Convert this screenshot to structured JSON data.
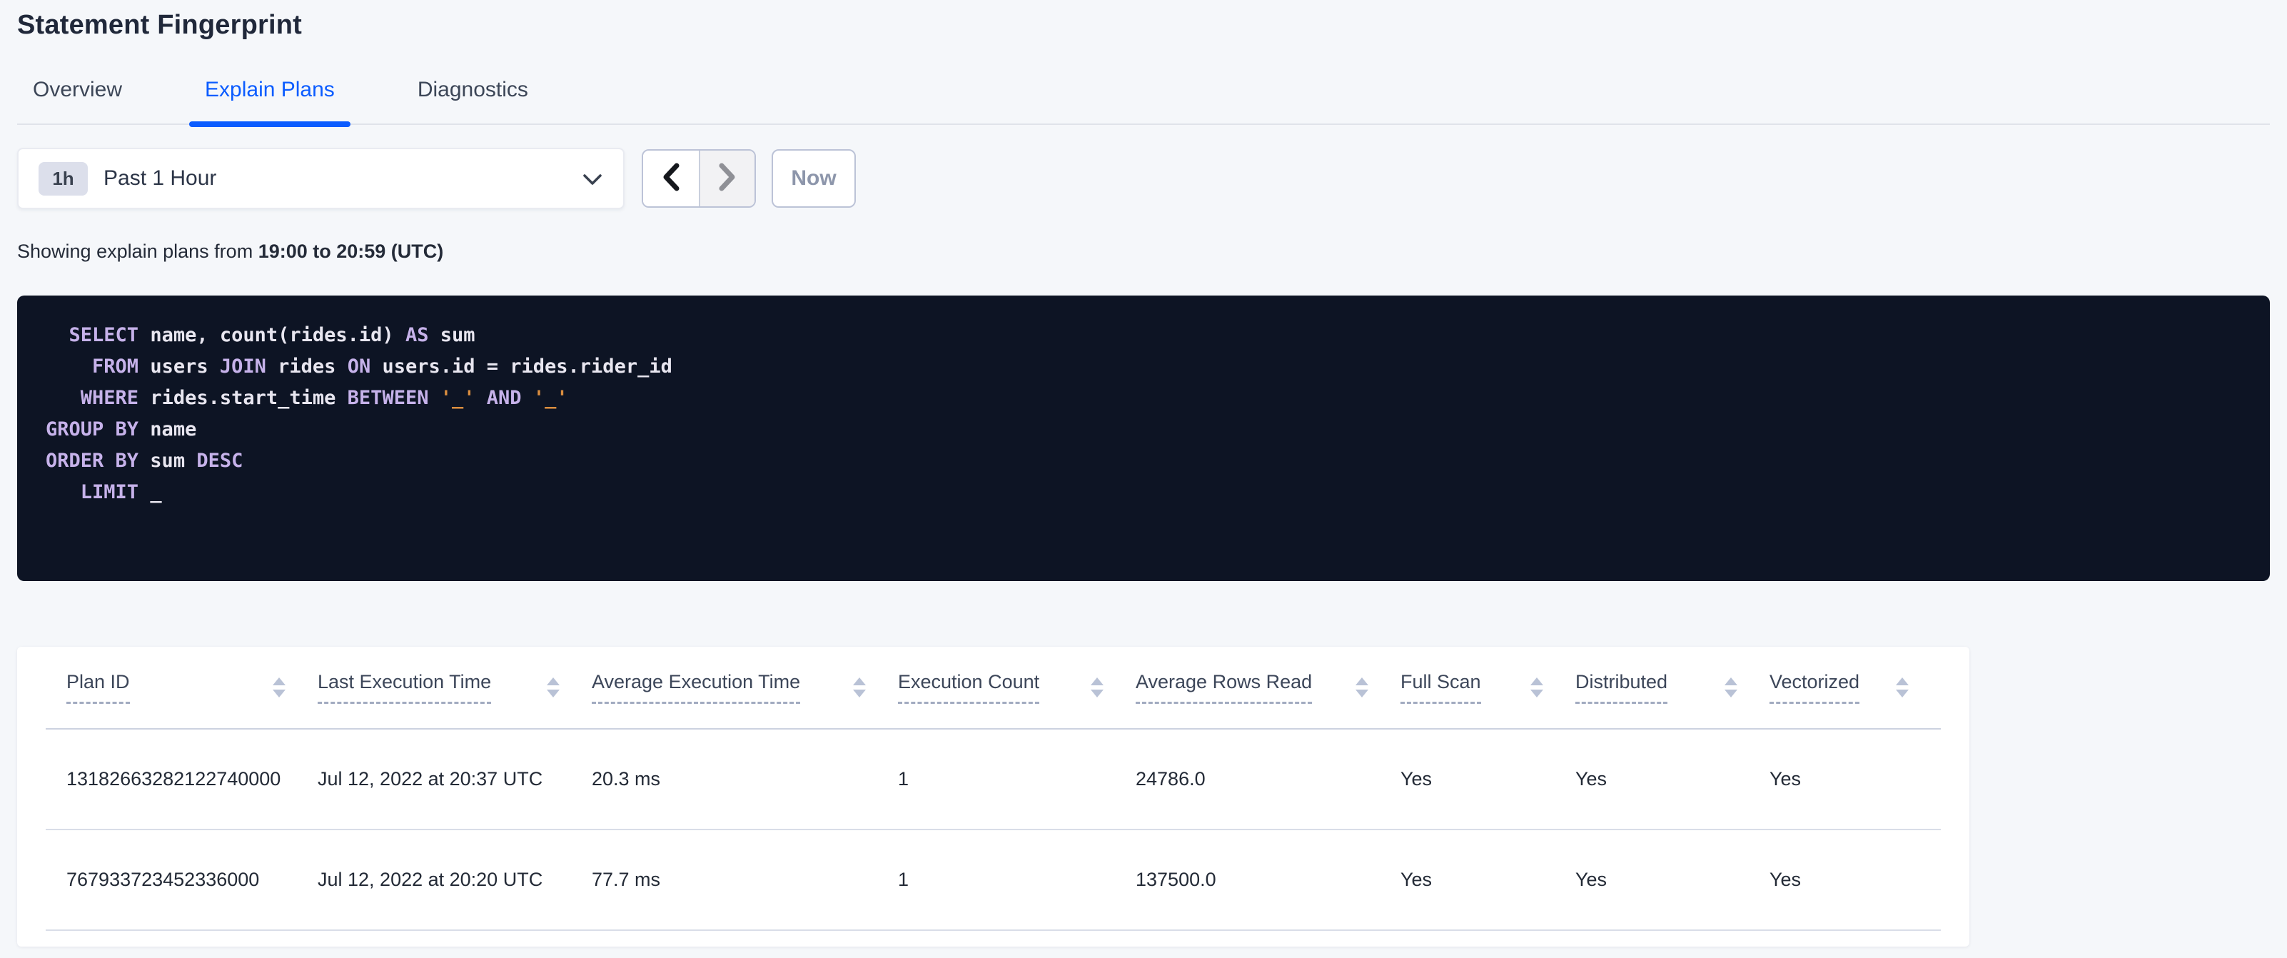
{
  "header": {
    "title": "Statement Fingerprint"
  },
  "tabs": [
    {
      "label": "Overview",
      "slug": "overview",
      "active": false
    },
    {
      "label": "Explain Plans",
      "slug": "explain-plans",
      "active": true
    },
    {
      "label": "Diagnostics",
      "slug": "diagnostics",
      "active": false
    }
  ],
  "time_picker": {
    "badge": "1h",
    "selected": "Past 1 Hour",
    "now_label": "Now"
  },
  "status_line": {
    "prefix": "Showing explain plans from ",
    "bold_range": "19:00 to 20:59 (UTC)"
  },
  "sql": {
    "lines": [
      [
        {
          "k": "p",
          "t": "  "
        },
        {
          "k": "kw",
          "t": "SELECT"
        },
        {
          "k": "p",
          "t": " name, count(rides.id) "
        },
        {
          "k": "kw",
          "t": "AS"
        },
        {
          "k": "p",
          "t": " sum"
        }
      ],
      [
        {
          "k": "p",
          "t": "    "
        },
        {
          "k": "kw",
          "t": "FROM"
        },
        {
          "k": "p",
          "t": " users "
        },
        {
          "k": "kw",
          "t": "JOIN"
        },
        {
          "k": "p",
          "t": " rides "
        },
        {
          "k": "kw",
          "t": "ON"
        },
        {
          "k": "p",
          "t": " users.id = rides.rider_id"
        }
      ],
      [
        {
          "k": "p",
          "t": "   "
        },
        {
          "k": "kw",
          "t": "WHERE"
        },
        {
          "k": "p",
          "t": " rides.start_time "
        },
        {
          "k": "kw",
          "t": "BETWEEN"
        },
        {
          "k": "p",
          "t": " "
        },
        {
          "k": "str",
          "t": "'_'"
        },
        {
          "k": "p",
          "t": " "
        },
        {
          "k": "kw",
          "t": "AND"
        },
        {
          "k": "p",
          "t": " "
        },
        {
          "k": "str",
          "t": "'_'"
        }
      ],
      [
        {
          "k": "kw",
          "t": "GROUP BY"
        },
        {
          "k": "p",
          "t": " name"
        }
      ],
      [
        {
          "k": "kw",
          "t": "ORDER BY"
        },
        {
          "k": "p",
          "t": " sum "
        },
        {
          "k": "kw",
          "t": "DESC"
        }
      ],
      [
        {
          "k": "p",
          "t": "   "
        },
        {
          "k": "kw",
          "t": "LIMIT"
        },
        {
          "k": "p",
          "t": " _"
        }
      ]
    ]
  },
  "table": {
    "columns": [
      {
        "label": "Plan ID",
        "slug": "plan-id"
      },
      {
        "label": "Last Execution Time",
        "slug": "last-execution-time"
      },
      {
        "label": "Average Execution Time",
        "slug": "average-execution-time"
      },
      {
        "label": "Execution Count",
        "slug": "execution-count"
      },
      {
        "label": "Average Rows Read",
        "slug": "average-rows-read"
      },
      {
        "label": "Full Scan",
        "slug": "full-scan"
      },
      {
        "label": "Distributed",
        "slug": "distributed"
      },
      {
        "label": "Vectorized",
        "slug": "vectorized"
      }
    ],
    "rows": [
      [
        "13182663282122740000",
        "Jul 12, 2022 at 20:37 UTC",
        "20.3 ms",
        "1",
        "24786.0",
        "Yes",
        "Yes",
        "Yes"
      ],
      [
        "767933723452336000",
        "Jul 12, 2022 at 20:20 UTC",
        "77.7 ms",
        "1",
        "137500.0",
        "Yes",
        "Yes",
        "Yes"
      ]
    ]
  },
  "colors": {
    "accent_blue": "#0b5cff",
    "code_background": "#0d1424",
    "code_keyword": "#c6b2ea",
    "code_plain": "#e8e6f0",
    "code_string": "#db8e3f",
    "page_background": "#f5f7fa"
  }
}
